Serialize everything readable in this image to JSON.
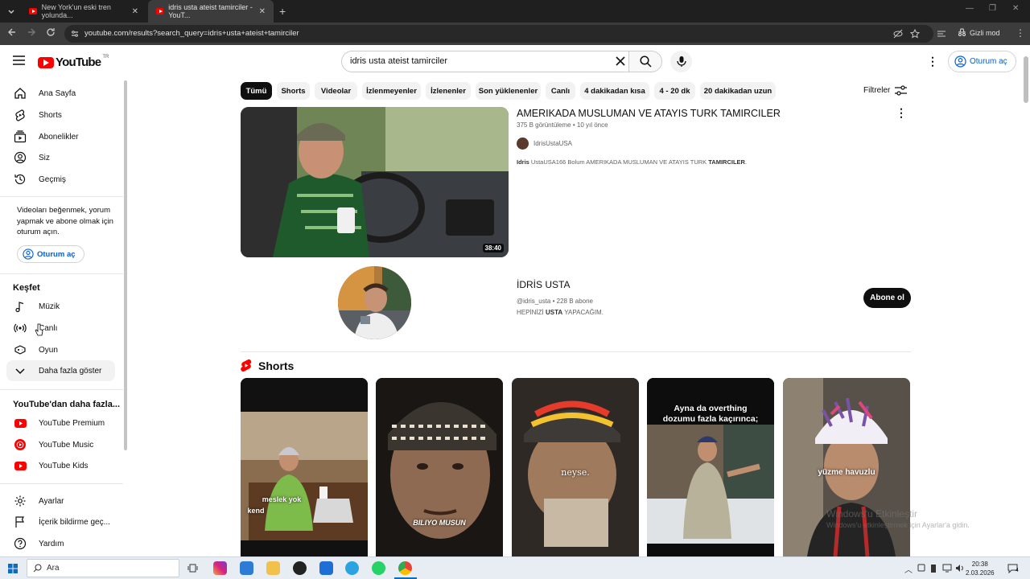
{
  "browser": {
    "tabs": [
      {
        "title": "New York'un eski tren yolunda..."
      },
      {
        "title": "idris usta ateist tamirciler - YouT..."
      }
    ],
    "url": "youtube.com/results?search_query=idris+usta+ateist+tamirciler",
    "incognito_label": "Gizli mod"
  },
  "header": {
    "logo_text": "YouTube",
    "logo_country": "TR",
    "search_value": "idris usta ateist tamirciler",
    "signin_label": "Oturum aç"
  },
  "sidebar": {
    "main": [
      {
        "label": "Ana Sayfa",
        "icon": "home-icon"
      },
      {
        "label": "Shorts",
        "icon": "shorts-icon"
      },
      {
        "label": "Abonelikler",
        "icon": "subscriptions-icon"
      },
      {
        "label": "Siz",
        "icon": "you-icon"
      },
      {
        "label": "Geçmiş",
        "icon": "history-icon"
      }
    ],
    "signin_message": "Videoları beğenmek, yorum yapmak ve abone olmak için oturum açın.",
    "signin_label": "Oturum aç",
    "explore_title": "Keşfet",
    "explore": [
      {
        "label": "Müzik",
        "icon": "music-icon"
      },
      {
        "label": "Canlı",
        "icon": "live-icon"
      },
      {
        "label": "Oyun",
        "icon": "gaming-icon"
      },
      {
        "label": "Daha fazla göster",
        "icon": "chevron-down-icon"
      }
    ],
    "more_title": "YouTube'dan daha fazla...",
    "more": [
      {
        "label": "YouTube Premium"
      },
      {
        "label": "YouTube Music"
      },
      {
        "label": "YouTube Kids"
      }
    ],
    "settings": [
      {
        "label": "Ayarlar",
        "icon": "gear-icon"
      },
      {
        "label": "İçerik bildirme geç...",
        "icon": "flag-icon"
      },
      {
        "label": "Yardım",
        "icon": "help-icon"
      }
    ]
  },
  "chips": [
    "Tümü",
    "Shorts",
    "Videolar",
    "İzlenmeyenler",
    "İzlenenler",
    "Son yüklenenler",
    "Canlı",
    "4 dakikadan kısa",
    "4 - 20 dk",
    "20 dakikadan uzun"
  ],
  "filters_label": "Filtreler",
  "video": {
    "title": "AMERIKADA MUSLUMAN VE ATAYIS TURK TAMIRCILER",
    "views": "375 B görüntüleme",
    "age": "10 yıl önce",
    "channel": "IdrisUstaUSA",
    "duration": "38:40",
    "desc_bold1": "Idris",
    "desc_mid": " UstaUSA166 Bolum AMERIKADA MUSLUMAN VE ATAYIS TURK ",
    "desc_bold2": "TAMIRCILER",
    "desc_end": "."
  },
  "channel": {
    "name": "İDRİS USTA",
    "handle": "@idris_usta",
    "subs": "228 B abone",
    "desc_pre": "HEPİNİZİ ",
    "desc_bold": "USTA",
    "desc_post": " YAPACAĞIM.",
    "subscribe_label": "Abone ol"
  },
  "shorts_title": "Shorts",
  "shorts": [
    {
      "caption1": "meslek yok",
      "caption2": "kend"
    },
    {
      "caption1": "BILIYO MUSUN",
      "caption2": ""
    },
    {
      "caption1": "neyse.",
      "caption2": ""
    },
    {
      "caption1": "Ayna da overthing dozumu fazla kaçırınca;",
      "caption2": ""
    },
    {
      "caption1": "yüzme havuzlu",
      "caption2": ""
    }
  ],
  "watermark": {
    "line1": "Windows'u Etkinleştir",
    "line2": "Windows'u etkinleştirmek için Ayarlar'a gidin."
  },
  "taskbar": {
    "search_placeholder": "Ara",
    "time": "20:38",
    "date": "2.03.2026",
    "notif_count": "4"
  },
  "colors": {
    "brand": "#ff0000",
    "link": "#065fd4"
  }
}
